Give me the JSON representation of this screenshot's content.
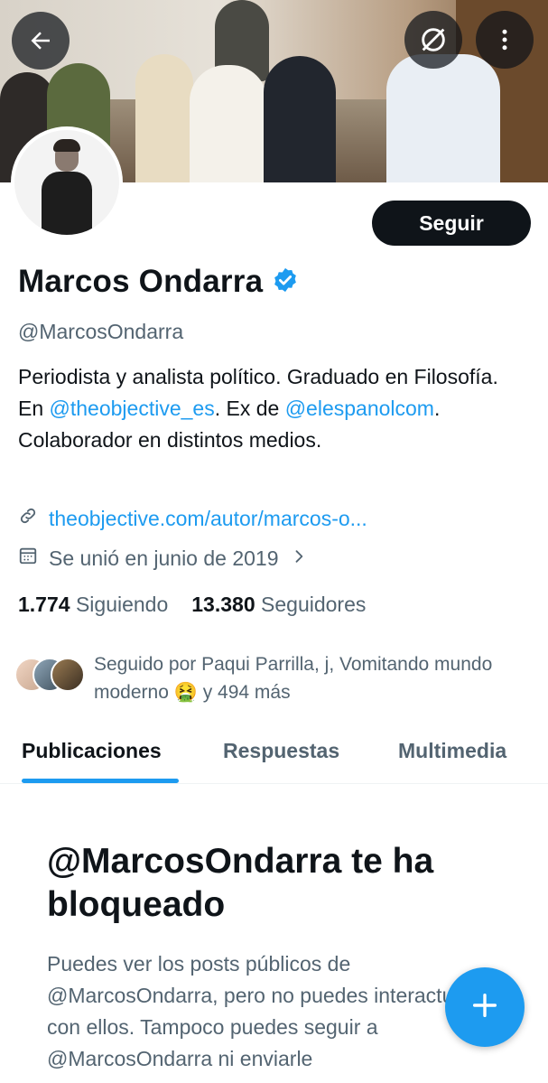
{
  "profile": {
    "display_name": "Marcos Ondarra",
    "handle": "@MarcosOndarra",
    "verified": true,
    "follow_label": "Seguir",
    "bio": {
      "part1": "Periodista y analista político. Graduado en Filosofía. En ",
      "mention1": "@theobjective_es",
      "part2": ". Ex de ",
      "mention2": "@elespanolcom",
      "part3": ". Colaborador en distintos medios."
    },
    "website": "theobjective.com/autor/marcos-o...",
    "joined": "Se unió en junio de 2019",
    "following_count": "1.774",
    "following_label": "Siguiendo",
    "followers_count": "13.380",
    "followers_label": "Seguidores",
    "followed_by": {
      "line1": "Seguido por Paqui Parrilla, j, Vomitando mundo",
      "line2_before_emoji": "moderno ",
      "emoji": "🤮",
      "line2_after_emoji": " y 494 más"
    }
  },
  "tabs": [
    {
      "label": "Publicaciones",
      "active": true
    },
    {
      "label": "Respuestas",
      "active": false
    },
    {
      "label": "Multimedia",
      "active": false
    }
  ],
  "blocked_notice": {
    "title": "@MarcosOndarra te ha bloqueado",
    "body": "Puedes ver los posts públicos de @MarcosOndarra, pero no puedes interactuar con ellos. Tampoco puedes seguir a @MarcosOndarra ni enviarle"
  },
  "icons": {
    "back": "arrow-left-icon",
    "translate_off": "globe-slash-icon",
    "more": "more-vertical-icon",
    "verified": "verified-badge-icon",
    "link": "link-icon",
    "calendar": "calendar-icon",
    "chevron": "chevron-right-icon",
    "compose": "plus-icon"
  },
  "colors": {
    "accent": "#1d9bf0",
    "text_primary": "#0f1419",
    "text_secondary": "#536471",
    "button_dark": "#0f1419"
  }
}
